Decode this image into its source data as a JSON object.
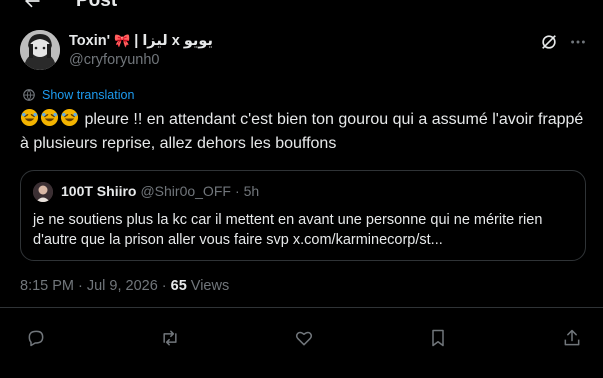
{
  "header": {
    "title": "Post",
    "back_icon": "arrow-left-icon"
  },
  "author": {
    "display_name": "Toxin'",
    "bow_emoji": "🎀",
    "name_suffix": "| لیزا x یویو",
    "handle": "@cryforyunh0",
    "avatar_icon": "avatar-image"
  },
  "top_icons": [
    "grok-icon",
    "more-icon"
  ],
  "translation": {
    "label": "Show translation"
  },
  "tweet": {
    "text": "pleure !! en attendant c'est bien ton gourou qui a assumé l'avoir frappé à plusieurs reprise, allez dehors les bouffons",
    "emoji": [
      "rolling-on-floor-laughing",
      "rolling-on-floor-laughing",
      "rolling-on-floor-laughing"
    ]
  },
  "quote": {
    "name": "100T Shiiro",
    "handle": "@Shir0o_OFF",
    "separator": "·",
    "time": "5h",
    "text": "je ne soutiens plus la kc car il mettent en avant une personne qui ne mérite rien d'autre que la prison aller vous faire svp x.com/karminecorp/st..."
  },
  "meta": {
    "time": "8:15 PM",
    "date": "Jul 9, 2026",
    "separator": "·",
    "views_count": "65",
    "views_label": "Views"
  },
  "actions": [
    "reply-icon",
    "repost-icon",
    "like-icon",
    "bookmark-icon",
    "share-icon"
  ],
  "colors": {
    "background": "#000000",
    "text": "#e7e9ea",
    "muted": "#71767b",
    "accent": "#1d9bf0",
    "border": "#2f3336"
  }
}
